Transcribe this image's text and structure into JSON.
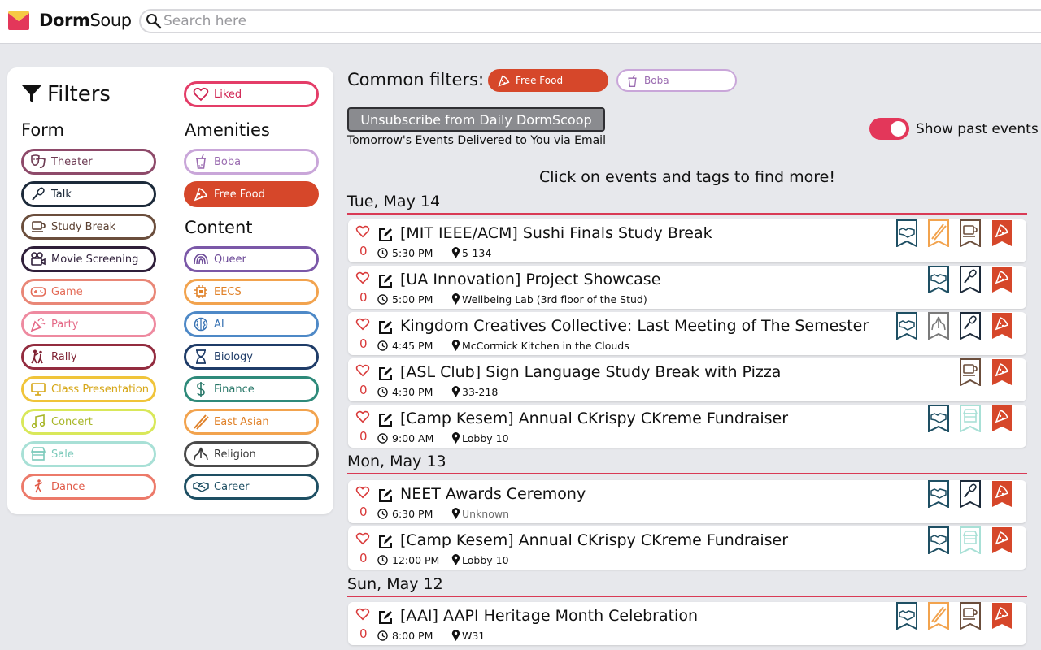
{
  "brand": {
    "logo_bold": "Dorm",
    "logo_thin": "Soup"
  },
  "search": {
    "placeholder": "Search here"
  },
  "filters": {
    "title": "Filters",
    "form_heading": "Form",
    "amenities_heading": "Amenities",
    "content_heading": "Content",
    "liked": "Liked",
    "form": [
      "Theater",
      "Talk",
      "Study Break",
      "Movie Screening",
      "Game",
      "Party",
      "Rally",
      "Class Presentation",
      "Concert",
      "Sale",
      "Dance"
    ],
    "amenities": [
      "Boba",
      "Free Food"
    ],
    "content": [
      "Queer",
      "EECS",
      "AI",
      "Biology",
      "Finance",
      "East Asian",
      "Religion",
      "Career"
    ],
    "active": "Free Food"
  },
  "common": {
    "label": "Common filters:",
    "chips": [
      "Free Food",
      "Boba"
    ]
  },
  "subscription": {
    "button": "Unsubscribe from Daily DormScoop",
    "subtitle": "Tomorrow's Events Delivered to You via Email"
  },
  "toggle": {
    "label": "Show past events",
    "on": true
  },
  "hint": "Click on events and tags to find more!",
  "days": [
    {
      "date": "Tue, May 14",
      "events": [
        {
          "title": "[MIT IEEE/ACM] Sushi Finals Study Break",
          "time": "5:30 PM",
          "location": "5-134",
          "likes": "0",
          "tags": [
            "career",
            "east-asian",
            "study-break",
            "free-food"
          ]
        },
        {
          "title": "[UA Innovation] Project Showcase",
          "time": "5:00 PM",
          "location": "Wellbeing Lab (3rd floor of the Stud)",
          "likes": "0",
          "tags": [
            "career",
            "talk",
            "free-food"
          ]
        },
        {
          "title": "Kingdom Creatives Collective: Last Meeting of The Semester",
          "time": "4:45 PM",
          "location": "McCormick Kitchen in the Clouds",
          "likes": "0",
          "tags": [
            "career",
            "religion",
            "talk",
            "free-food"
          ]
        },
        {
          "title": "[ASL Club] Sign Language Study Break with Pizza",
          "time": "4:30 PM",
          "location": "33-218",
          "likes": "0",
          "tags": [
            "study-break",
            "free-food"
          ]
        },
        {
          "title": "[Camp Kesem] Annual CKrispy CKreme Fundraiser",
          "time": "9:00 AM",
          "location": "Lobby 10",
          "likes": "0",
          "tags": [
            "career",
            "sale",
            "free-food"
          ]
        }
      ]
    },
    {
      "date": "Mon, May 13",
      "events": [
        {
          "title": "NEET Awards Ceremony",
          "time": "6:30 PM",
          "location": "Unknown",
          "likes": "0",
          "tags": [
            "career",
            "talk",
            "free-food"
          ]
        },
        {
          "title": "[Camp Kesem] Annual CKrispy CKreme Fundraiser",
          "time": "12:00 PM",
          "location": "Lobby 10",
          "likes": "0",
          "tags": [
            "career",
            "sale",
            "free-food"
          ]
        }
      ]
    },
    {
      "date": "Sun, May 12",
      "events": [
        {
          "title": "[AAI] AAPI Heritage Month Celebration",
          "time": "8:00 PM",
          "location": "W31",
          "likes": "0",
          "tags": [
            "career",
            "east-asian",
            "study-break",
            "free-food"
          ]
        }
      ]
    }
  ],
  "colors": {
    "accent": "#e3375a",
    "free_food": "#d6472a",
    "career": "#1e4f63",
    "east_asian": "#f2a34e",
    "study_break": "#6b4e3c",
    "talk": "#1c2a3a",
    "religion": "#7a7a7a",
    "sale": "#a8e0d6"
  }
}
